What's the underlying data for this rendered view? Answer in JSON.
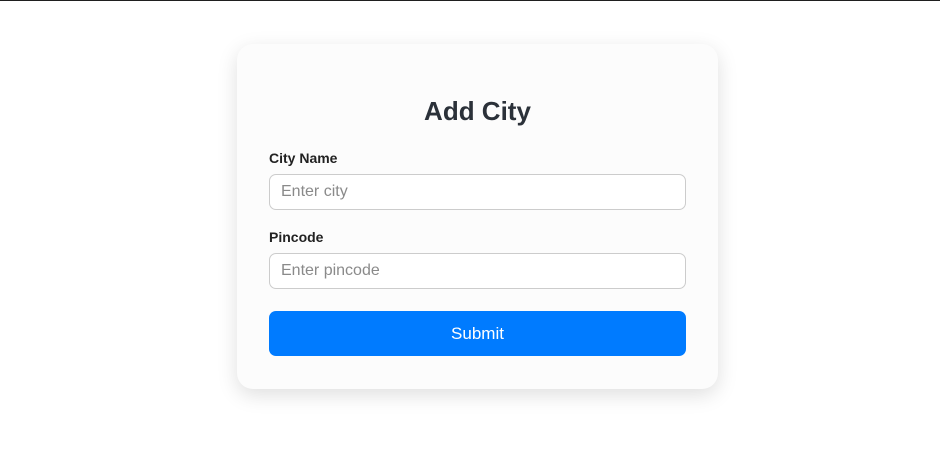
{
  "form": {
    "title": "Add City",
    "city_label": "City Name",
    "city_placeholder": "Enter city",
    "city_value": "",
    "pincode_label": "Pincode",
    "pincode_placeholder": "Enter pincode",
    "pincode_value": "",
    "submit_label": "Submit"
  },
  "colors": {
    "accent": "#007bff",
    "title_text": "#2b3139",
    "card_background": "#fcfcfc",
    "input_border": "#cccccc"
  }
}
